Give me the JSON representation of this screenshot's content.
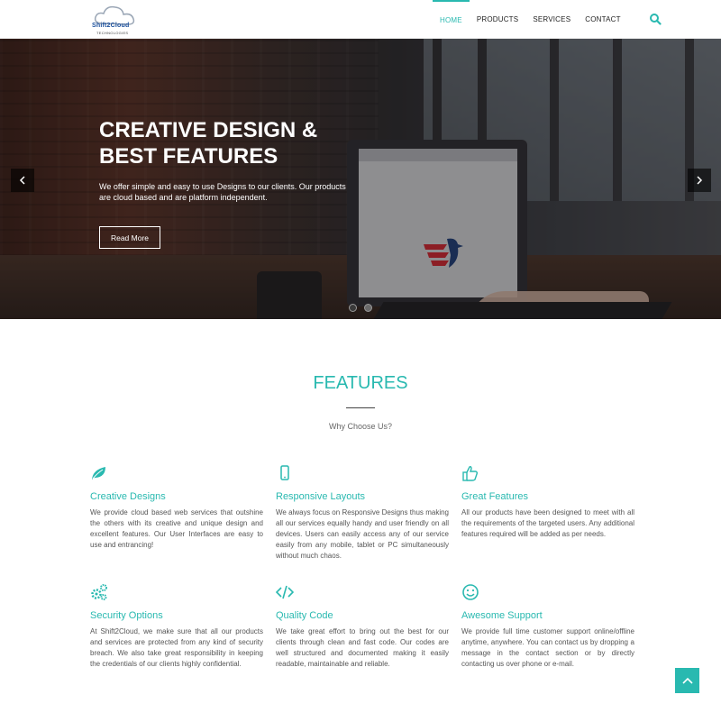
{
  "brand": {
    "logo_text": "Shift2Cloud",
    "logo_sub": "TECHNOLOGIES"
  },
  "nav": {
    "items": [
      {
        "label": "HOME",
        "active": true
      },
      {
        "label": "PRODUCTS",
        "active": false
      },
      {
        "label": "SERVICES",
        "active": false
      },
      {
        "label": "CONTACT",
        "active": false
      }
    ],
    "search_icon": "search-icon"
  },
  "hero": {
    "title_line1": "CREATIVE DESIGN &",
    "title_line2": "BEST FEATURES",
    "description": "We offer simple and easy to use Designs to our clients. Our products are cloud based and are platform independent.",
    "button_label": "Read More",
    "slides": 2,
    "active_slide": 1
  },
  "features": {
    "title": "FEATURES",
    "subtitle": "Why Choose Us?",
    "items": [
      {
        "icon": "leaf-icon",
        "title": "Creative Designs",
        "text": "We provide cloud based web services that outshine the others with its creative and unique design and excellent features. Our User Interfaces are easy to use and entrancing!"
      },
      {
        "icon": "mobile-icon",
        "title": "Responsive Layouts",
        "text": "We always focus on Responsive Designs thus making all our services equally handy and user friendly on all devices. Users can easily access any of our service easily from any mobile, tablet or PC simultaneously without much chaos."
      },
      {
        "icon": "thumbs-up-icon",
        "title": "Great Features",
        "text": "All our products have been designed to meet with all the requirements of the targeted users. Any additional features required will be added as per needs."
      },
      {
        "icon": "gears-icon",
        "title": "Security Options",
        "text": "At Shift2Cloud, we make sure that all our products and services are protected from any kind of security breach. We also take great responsibility in keeping the credentials of our clients highly confidential."
      },
      {
        "icon": "code-icon",
        "title": "Quality Code",
        "text": "We take great effort to bring out the best for our clients through clean and fast code. Our codes are well structured and documented making it easily readable, maintainable and reliable."
      },
      {
        "icon": "smile-icon",
        "title": "Awesome Support",
        "text": "We provide full time customer support online/offline anytime, anywhere. You can contact us by dropping a message in the contact section or by directly contacting us over phone or e-mail."
      }
    ]
  },
  "colors": {
    "accent": "#29b9b0",
    "text": "#555555"
  }
}
